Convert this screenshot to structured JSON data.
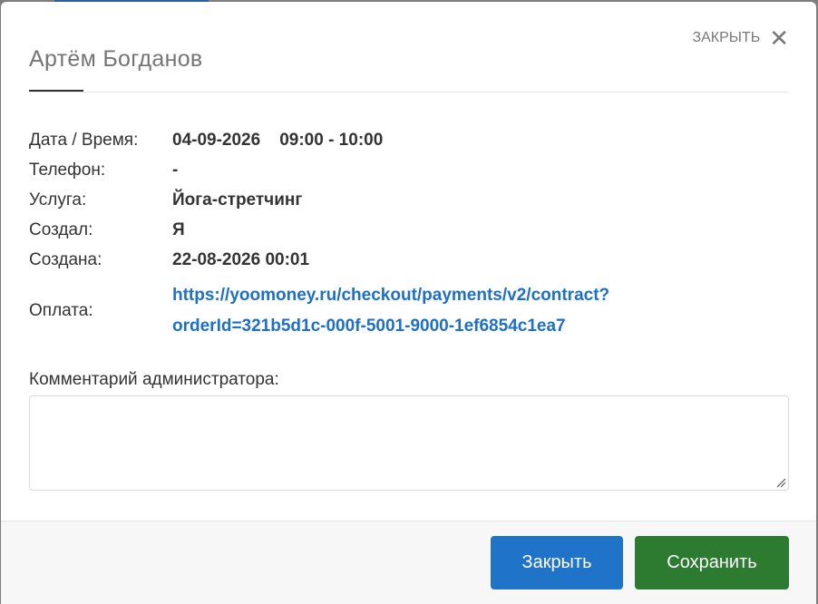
{
  "modal": {
    "title": "Артём Богданов",
    "close_label": "ЗАКРЫТЬ"
  },
  "details": {
    "date_label": "Дата / Время:",
    "date": "04-09-2026",
    "time": "09:00 - 10:00",
    "phone_label": "Телефон:",
    "phone": "-",
    "service_label": "Услуга:",
    "service": "Йога-стретчинг",
    "created_by_label": "Создал:",
    "created_by": "Я",
    "created_label": "Создана:",
    "created": "22-08-2026 00:01",
    "payment_label": "Оплата:",
    "payment_line1": "https://yoomoney.ru/checkout/payments/v2/contract?",
    "payment_line2": "orderId=321b5d1c-000f-5001-9000-1ef6854c1ea7"
  },
  "comment": {
    "label": "Комментарий администратора:",
    "value": ""
  },
  "footer": {
    "close_button": "Закрыть",
    "save_button": "Сохранить"
  },
  "colors": {
    "link": "#1d6fc9",
    "primary": "#1f73c8",
    "success": "#2d7a31"
  }
}
